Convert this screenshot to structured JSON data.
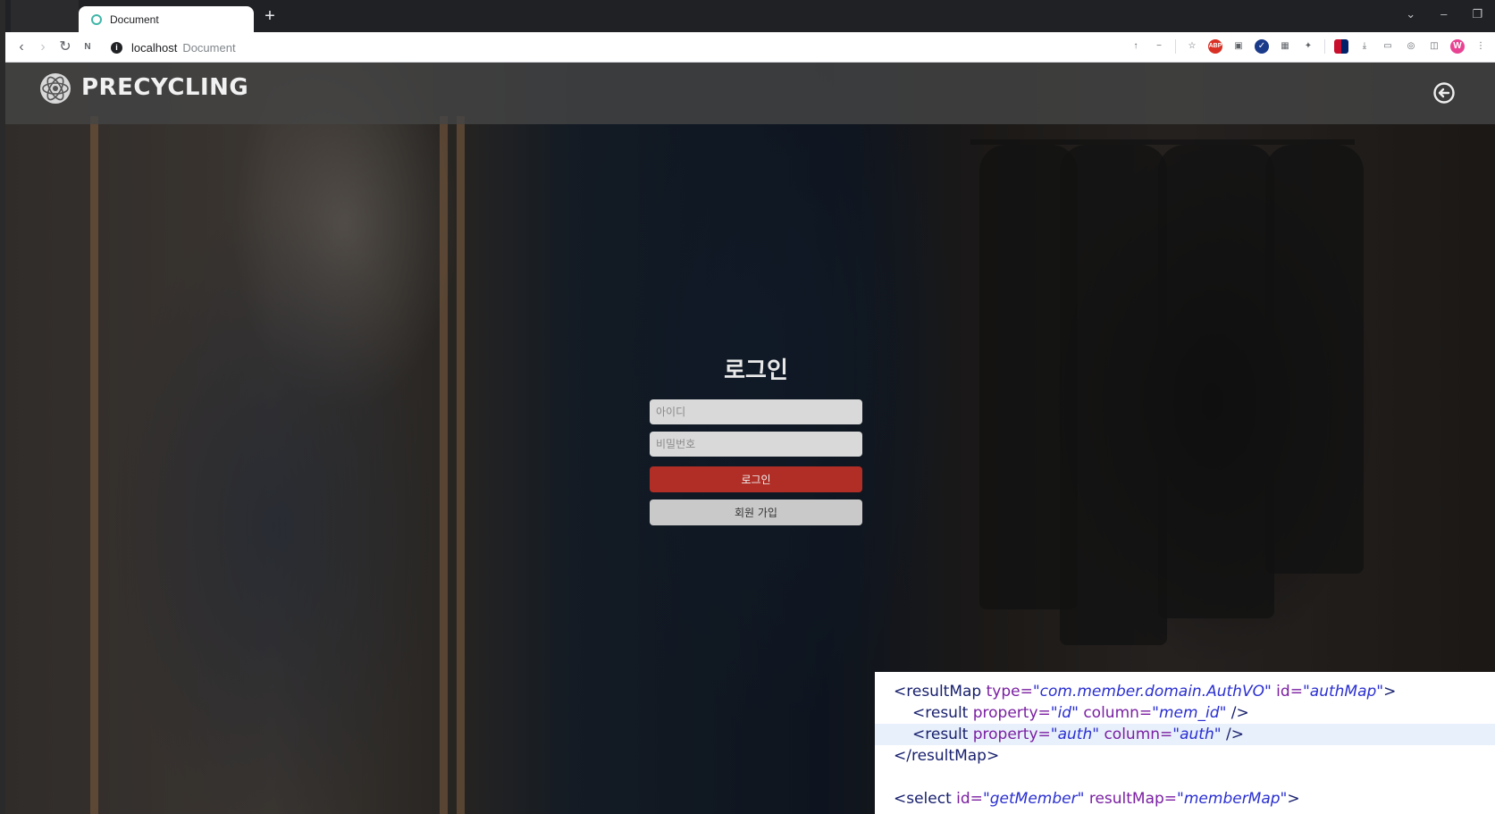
{
  "browser": {
    "tab_title": "Document",
    "new_tab": "+",
    "url_host": "localhost",
    "url_title": "Document",
    "window_controls": [
      "⌄",
      "–",
      "❐"
    ],
    "profile_initial": "W"
  },
  "site": {
    "brand": "PRECYCLING",
    "logo_icon": "atom-globe-icon",
    "logout_icon": "logout-arrow-icon"
  },
  "login": {
    "title": "로그인",
    "id_placeholder": "아이디",
    "password_placeholder": "비밀번호",
    "login_label": "로그인",
    "join_label": "회원 가입"
  },
  "code": {
    "lines": [
      {
        "indent": 0,
        "open": "<resultMap",
        "parts": [
          [
            "type=",
            "\"com.member.domain.AuthVO\""
          ],
          [
            "id=",
            "\"authMap\""
          ]
        ],
        "close": ">"
      },
      {
        "indent": 1,
        "open": "<result",
        "parts": [
          [
            "property=",
            "\"id\""
          ],
          [
            "column=",
            "\"mem_id\""
          ]
        ],
        "close": " />"
      },
      {
        "indent": 1,
        "open": "<result",
        "parts": [
          [
            "property=",
            "\"auth\""
          ],
          [
            "column=",
            "\"auth\""
          ]
        ],
        "close": " />"
      },
      {
        "indent": 0,
        "open": "</resultMap>",
        "parts": [],
        "close": ""
      },
      {
        "indent": 0,
        "open": "",
        "parts": [],
        "close": ""
      },
      {
        "indent": 0,
        "open": "<select",
        "parts": [
          [
            "id=",
            "\"getMember\""
          ],
          [
            "resultMap=",
            "\"memberMap\""
          ]
        ],
        "close": ">"
      }
    ]
  },
  "colors": {
    "accent_red": "#b02e26",
    "header_bg": "#444444"
  }
}
